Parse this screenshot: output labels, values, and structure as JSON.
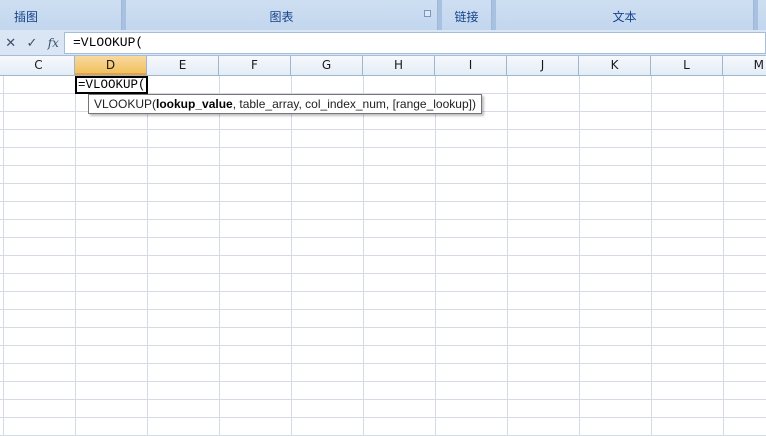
{
  "ribbon": {
    "groups": [
      {
        "label": "插图",
        "has_launcher": false
      },
      {
        "label": "图表",
        "has_launcher": true
      },
      {
        "label": "链接",
        "has_launcher": false
      },
      {
        "label": "文本",
        "has_launcher": false
      }
    ]
  },
  "formula_bar": {
    "cancel_icon": "x-icon",
    "enter_icon": "check-icon",
    "fx_label": "fx",
    "formula": "=VLOOKUP("
  },
  "columns": {
    "headers": [
      "C",
      "D",
      "E",
      "F",
      "G",
      "H",
      "I",
      "J",
      "K",
      "L",
      "M"
    ],
    "active": "D"
  },
  "active_cell": {
    "value": "=VLOOKUP("
  },
  "tooltip": {
    "function_name": "VLOOKUP(",
    "current_arg": "lookup_value",
    "rest_args": ", table_array, col_index_num, [range_lookup])"
  },
  "colors": {
    "ribbon_bg": "#bfd3ec",
    "ribbon_text": "#15428b",
    "active_header": "#f1c15f",
    "gridline": "#d4dbe5"
  }
}
